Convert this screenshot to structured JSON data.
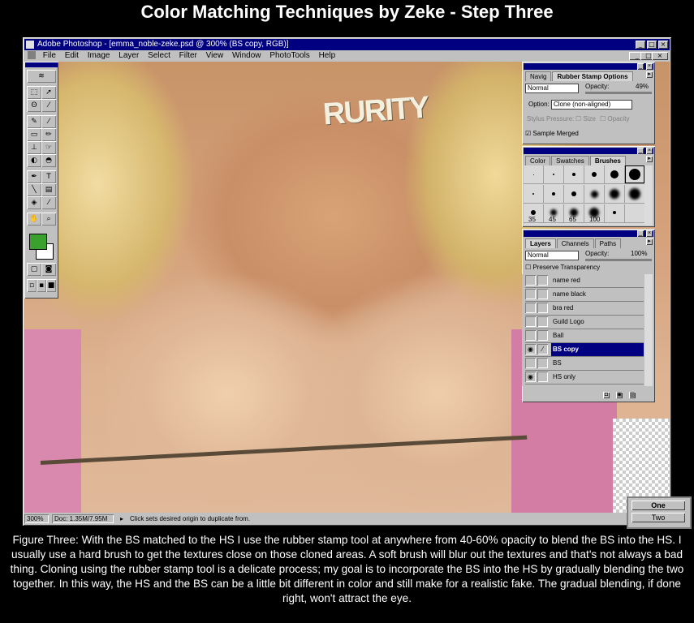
{
  "page": {
    "title": "Color Matching Techniques by Zeke - Step Three",
    "caption": "Figure Three: With the BS matched to the HS I use the rubber stamp tool at anywhere from 40-60% opacity to blend the BS into the HS. I usually use a hard brush to get the textures close on those cloned areas. A soft brush will blur out the textures and that's not always a bad thing. Cloning using the rubber stamp tool is a delicate process; my goal is to incorporate the BS into the HS by gradually blending the two together. In this way, the HS and the BS can be a little bit different in color and still make for a realistic fake. The gradual blending, if done right, won't attract the eye."
  },
  "app": {
    "title": "Adobe Photoshop - [emma_noble-zeke.psd @ 300% (BS copy, RGB)]",
    "menu": [
      "File",
      "Edit",
      "Image",
      "Layer",
      "Select",
      "Filter",
      "View",
      "Window",
      "PhotoTools",
      "Help"
    ],
    "canvas_text": "RURITY",
    "foreground_color": "#3aa12e",
    "background_color": "#ffffff"
  },
  "rubber_stamp_panel": {
    "tabs": [
      "Navig",
      "Rubber Stamp Options"
    ],
    "mode": "Normal",
    "opacity_label": "Opacity:",
    "opacity_value": "49%",
    "option_label": "Option:",
    "option_value": "Clone (non-aligned)",
    "stylus_label": "Stylus Pressure:",
    "size_label": "Size",
    "opacity_check_label": "Opacity",
    "sample_merged": "Sample Merged"
  },
  "brushes_panel": {
    "tabs": [
      "Color",
      "Swatches",
      "Brushes"
    ],
    "labels": [
      "35",
      "45",
      "65",
      "100"
    ]
  },
  "layers_panel": {
    "tabs": [
      "Layers",
      "Channels",
      "Paths"
    ],
    "mode": "Normal",
    "opacity_label": "Opacity:",
    "opacity_value": "100%",
    "preserve": "Preserve Transparency",
    "layers": [
      {
        "name": "name red",
        "visible": false,
        "selected": false
      },
      {
        "name": "name black",
        "visible": false,
        "selected": false
      },
      {
        "name": "bra red",
        "visible": false,
        "selected": false
      },
      {
        "name": "Guild Logo",
        "visible": false,
        "selected": false
      },
      {
        "name": "Ball",
        "visible": false,
        "selected": false
      },
      {
        "name": "BS copy",
        "visible": true,
        "selected": true
      },
      {
        "name": "BS",
        "visible": false,
        "selected": false
      },
      {
        "name": "HS only",
        "visible": true,
        "selected": false
      }
    ]
  },
  "status": {
    "zoom": "300%",
    "doc": "Doc: 1.35M/7.95M",
    "hint": "Click sets desired origin to duplicate from."
  },
  "mini_window": {
    "buttons": [
      "One",
      "Two"
    ]
  }
}
